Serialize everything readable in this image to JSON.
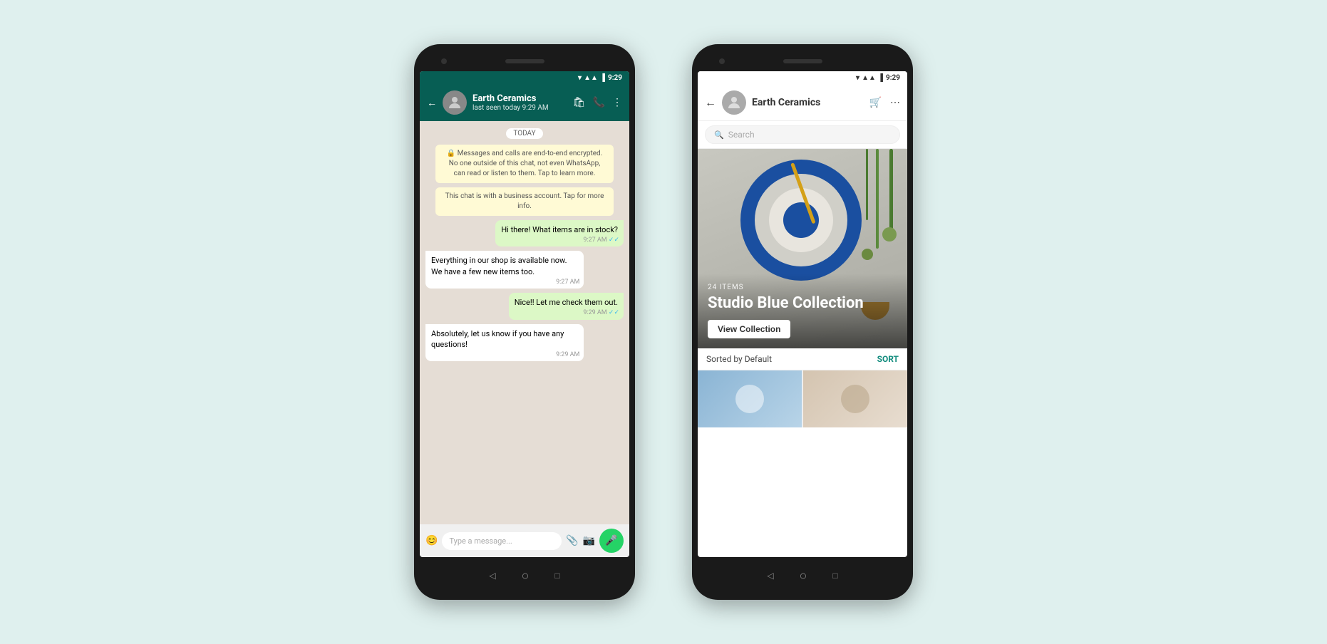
{
  "background_color": "#dff0ee",
  "phone1": {
    "status_bar": {
      "time": "9:29",
      "bg_color": "#075e54"
    },
    "header": {
      "back_label": "←",
      "name": "Earth Ceramics",
      "status": "last seen today 9:29 AM"
    },
    "messages": [
      {
        "type": "date",
        "text": "TODAY"
      },
      {
        "type": "system",
        "text": "🔒 Messages and calls are end-to-end encrypted. No one outside of this chat, not even WhatsApp, can read or listen to them. Tap to learn more."
      },
      {
        "type": "system",
        "text": "This chat is with a business account. Tap for more info."
      },
      {
        "type": "out",
        "text": "Hi there! What items are in stock?",
        "time": "9:27 AM",
        "ticks": "✓✓"
      },
      {
        "type": "in",
        "text": "Everything in our shop is available now. We have a few new items too.",
        "time": "9:27 AM"
      },
      {
        "type": "out",
        "text": "Nice!! Let me check them out.",
        "time": "9:29 AM",
        "ticks": "✓✓"
      },
      {
        "type": "in",
        "text": "Absolutely, let us know if you have any questions!",
        "time": "9:29 AM"
      }
    ],
    "input": {
      "placeholder": "Type a message..."
    }
  },
  "phone2": {
    "status_bar": {
      "time": "9:29"
    },
    "header": {
      "back_label": "←",
      "name": "Earth Ceramics"
    },
    "search": {
      "placeholder": "Search"
    },
    "banner": {
      "count": "24 ITEMS",
      "title": "Studio Blue Collection",
      "button_label": "View Collection"
    },
    "sort": {
      "label": "Sorted by Default",
      "button_label": "SORT"
    }
  }
}
